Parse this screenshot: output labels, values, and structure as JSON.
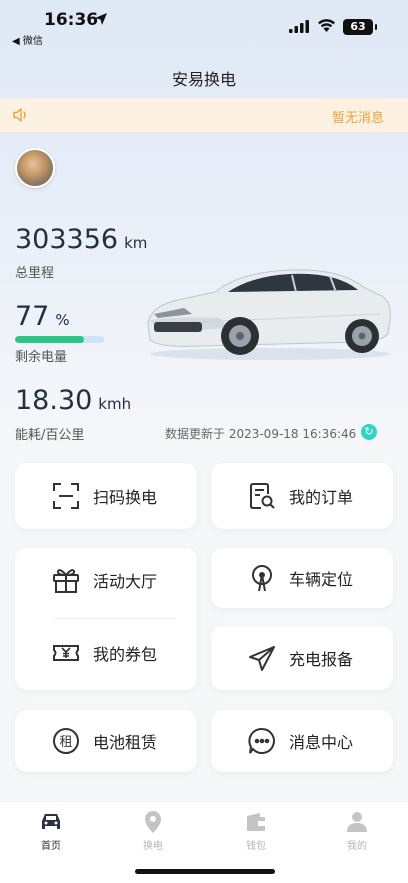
{
  "status_bar": {
    "time": "16:36",
    "back_app": "◀ 微信",
    "battery": "63"
  },
  "nav": {
    "title": "安易换电"
  },
  "notice": {
    "text": "暂无消息",
    "icon": "speaker-icon"
  },
  "stats": {
    "mileage_value": "303356",
    "mileage_unit": "km",
    "mileage_label": "总里程",
    "battery_value": "77",
    "battery_unit": "%",
    "battery_label": "剩余电量",
    "battery_level": 0.77,
    "energy_value": "18.30",
    "energy_unit": "kmh",
    "energy_label": "能耗/百公里",
    "updated_text": "数据更新于 2023-09-18 16:36:46"
  },
  "actions": {
    "scan_swap": "扫码换电",
    "my_orders": "我的订单",
    "activity_hall": "活动大厅",
    "vehicle_location": "车辆定位",
    "my_coupons": "我的券包",
    "charge_report": "充电报备",
    "battery_rental": "电池租赁",
    "message_center": "消息中心"
  },
  "tabs": [
    {
      "label": "首页",
      "icon": "car-icon",
      "active": true
    },
    {
      "label": "换电",
      "icon": "map-pin-icon",
      "active": false
    },
    {
      "label": "钱包",
      "icon": "wallet-icon",
      "active": false
    },
    {
      "label": "我的",
      "icon": "user-icon",
      "active": false
    }
  ],
  "colors": {
    "accent_green": "#2ec486",
    "notice_orange": "#e6a33a",
    "refresh_teal": "#31d3c4"
  }
}
